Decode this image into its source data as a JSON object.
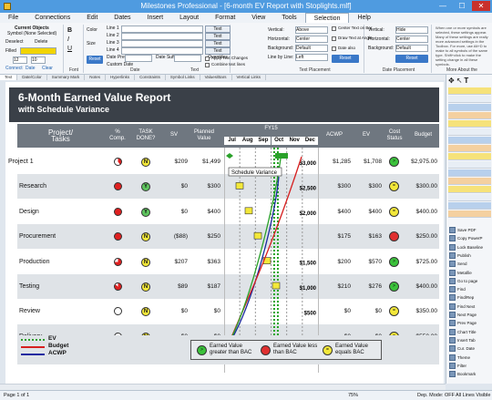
{
  "window": {
    "title": "Milestones Professional - [6-month EV Report with Stoplights.mlf]",
    "min": "—",
    "max": "☐",
    "close": "✕"
  },
  "menu": [
    "File",
    "Connections",
    "Edit",
    "Dates",
    "Insert",
    "Layout",
    "Format",
    "View",
    "Tools",
    "Selection",
    "Help"
  ],
  "menu_active": "Selection",
  "ribbon": {
    "current_objects_title": "Current Objects",
    "current_objects_sub": "Symbol (None Selected)",
    "deselect": "Deselect",
    "delete": "Delete",
    "filled": "Filled",
    "font_size": "12",
    "zoom": "10",
    "connect_btn": "Connect",
    "date_btn": "Date",
    "clear_btn": "Clear",
    "font_group": "Font",
    "color_label": "Color",
    "line1": "Line 1",
    "line2": "Line 2",
    "line3": "Line 3",
    "line4": "Line 4",
    "size_label": "Size",
    "date_prefix": "Date Prefix",
    "date_suffix": "Date Suffix",
    "custom_date": "Custom Date",
    "reset": "Reset",
    "text_overrides": [
      "Text Overrides",
      "Text Overrides",
      "Text Overrides",
      "Text Overrides"
    ],
    "apply_text": "Apply Text Changes",
    "combine": "Combine text lines",
    "date_group": "Date",
    "text_group": "Text",
    "vertical_label": "Vertical:",
    "horizontal_label": "Horizontal:",
    "background_label": "Background:",
    "line_by_line": "Line by Line:",
    "vertical_val": "Above",
    "horizontal_val": "Center",
    "background_val": "Default",
    "linebyline_val": "Left",
    "center_text": "Center Text on Bar",
    "draw_text": "Draw Text at Angle",
    "date_also": "Date also",
    "text_placement_group": "Text Placement",
    "dp_vertical_val": "Hide",
    "dp_horizontal_val": "Center",
    "dp_background_val": "Default",
    "date_placement_group": "Date Placement",
    "about_group": "More About the",
    "about_text": "When one or more symbols are selected, these settings appear. Many of these settings are really more advanced settings in the Toolbox. For more, use Alt+D to make to all symbols of the same type. Shift+click to make the setting change in all these symbols."
  },
  "tabs": [
    "Text",
    "Date/Color",
    "Summary Mark",
    "Notes",
    "Hyperlinks",
    "Constraints",
    "Symbol Links",
    "Values/Bars",
    "Vertical Links"
  ],
  "report": {
    "title": "6-Month Earned Value Report",
    "subtitle": "with Schedule Variance",
    "headers": {
      "project": "Project/\nTasks",
      "pct": "%\nComp.",
      "done": "TASK\nDONE?",
      "sv": "SV",
      "pv": "Planned\nValue",
      "fy": "FY15",
      "acwp": "ACWP",
      "ev": "EV",
      "cost": "Cost\nStatus",
      "budget": "Budget"
    },
    "months": [
      "Jul",
      "Aug",
      "Sep",
      "Oct",
      "Nov",
      "Dec"
    ],
    "rows": [
      {
        "name": "Project 1",
        "pct": 0.4,
        "done": "N",
        "sv": "$209",
        "pv": "$1,499",
        "bar": "$3,000",
        "acwp": "$1,285",
        "ev": "$1,708",
        "status": "green",
        "budget": "$2,975.00"
      },
      {
        "name": "Research",
        "pct": 1.0,
        "done": "Y",
        "sv": "$0",
        "pv": "$300",
        "bar": "$2,500",
        "acwp": "$300",
        "ev": "$300",
        "status": "yellow",
        "budget": "$300.00"
      },
      {
        "name": "Design",
        "pct": 1.0,
        "done": "Y",
        "sv": "$0",
        "pv": "$400",
        "bar": "$2,000",
        "acwp": "$400",
        "ev": "$400",
        "status": "yellow",
        "budget": "$400.00"
      },
      {
        "name": "Procurement",
        "pct": 1.0,
        "done": "N",
        "sv": "($88)",
        "pv": "$250",
        "bar": "",
        "acwp": "$175",
        "ev": "$163",
        "status": "red",
        "budget": "$250.00"
      },
      {
        "name": "Production",
        "pct": 0.75,
        "done": "N",
        "sv": "$207",
        "pv": "$363",
        "bar": "$1,500",
        "acwp": "$200",
        "ev": "$570",
        "status": "green",
        "budget": "$725.00"
      },
      {
        "name": "Testing",
        "pct": 0.85,
        "done": "N",
        "sv": "$89",
        "pv": "$187",
        "bar": "$1,000",
        "acwp": "$210",
        "ev": "$276",
        "status": "green",
        "budget": "$400.00"
      },
      {
        "name": "Review",
        "pct": 0,
        "done": "N",
        "sv": "$0",
        "pv": "$0",
        "bar": "$500",
        "acwp": "$0",
        "ev": "$0",
        "status": "yellow",
        "budget": "$350.00"
      },
      {
        "name": "Delivery",
        "pct": 0,
        "done": "N",
        "sv": "$0",
        "pv": "$0",
        "bar": "$0",
        "acwp": "$0",
        "ev": "$0",
        "status": "yellow",
        "budget": "$550.00"
      }
    ],
    "callout": "Schedule Variance",
    "legend_lines": [
      "EV",
      "Budget",
      "ACWP"
    ],
    "legend_status": [
      "Earned Value greater than BAC",
      "Earned Value less than BAC",
      "Earned Value equals BAC"
    ],
    "colors": {
      "ev": "#2aa12a",
      "budget": "#d62020",
      "acwp": "#1a2aa0",
      "green": "#3bc23b",
      "red": "#e03030",
      "yellow": "#f3e83a",
      "header": "#3a4048",
      "colhdr": "#6f7780"
    }
  },
  "sidebar": [
    "Save PDF",
    "Copy PowerP",
    "Lock Baseline",
    "Publish",
    "Send",
    "Metafile",
    "Go to page",
    "Find",
    "Find/Rep",
    "Find Next",
    "Next Page",
    "Prev Page",
    "Chart Title",
    "Insert Tab",
    "Cur. Date",
    "Theme",
    "Filter",
    "Bookmark"
  ],
  "statusbar": {
    "page": "Page 1 of 1",
    "zoom": "75%",
    "dep": "Dep. Mode: OFF",
    "lines": "All Lines Visible"
  }
}
